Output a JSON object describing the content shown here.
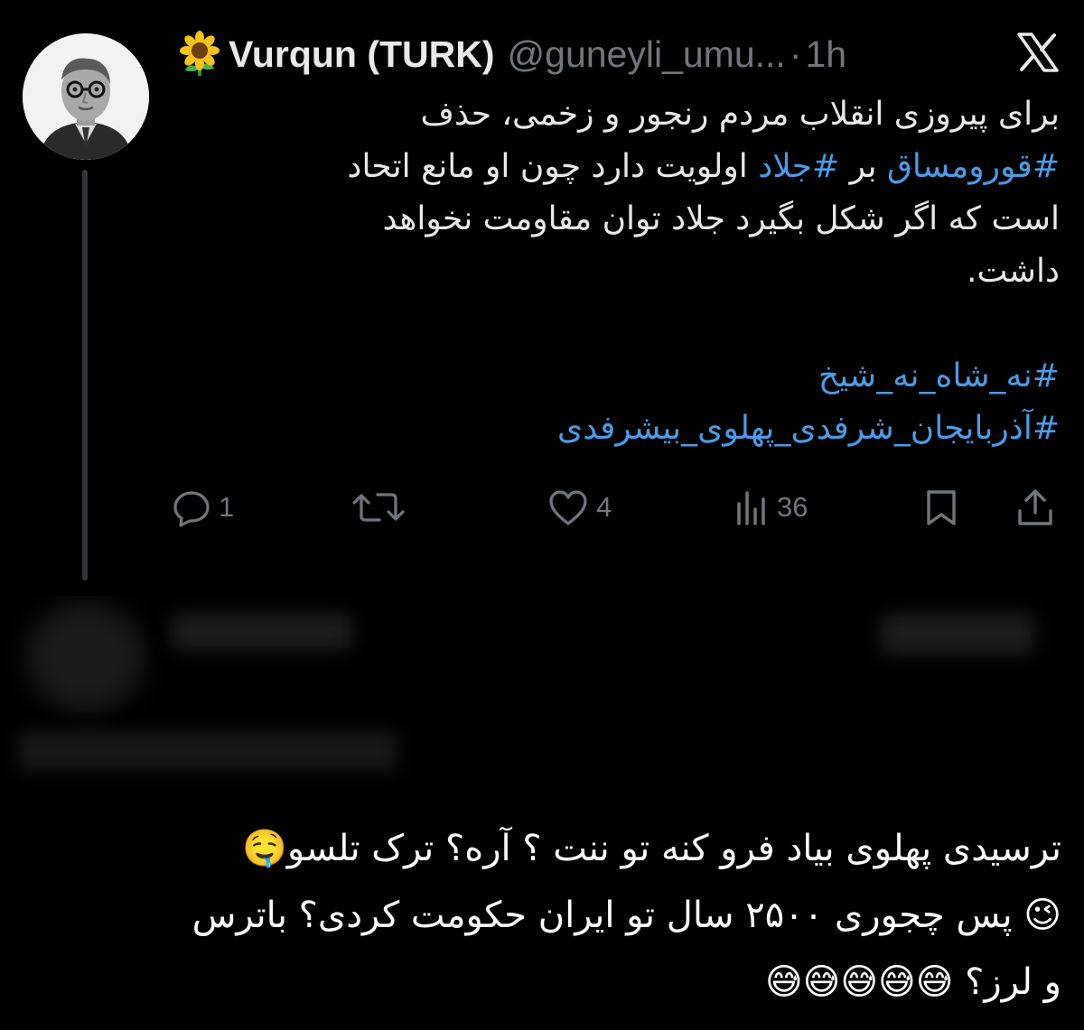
{
  "tweet": {
    "display_name": "Vurqun (TURK)",
    "handle": "@guneyli_umu...",
    "separator": "·",
    "time": "1h",
    "text_lines": [
      "برای پیروزی انقلاب مردم رنجور و زخمی، حذف",
      "اولویت دارد چون او مانع اتحاد",
      "است که اگر شکل بگیرد جلاد توان مقاومت نخواهد",
      "داشت."
    ],
    "line2_hashtag1": "#قورومساق",
    "line2_connector": "بر",
    "line2_hashtag2": "#جلاد",
    "hashtag_a": "#نه_شاه_نه_شیخ",
    "hashtag_b": "#آذربایجان_شرفدی_پهلوی_بیشرفدی"
  },
  "actions": {
    "reply_count": "1",
    "retweet_count": "",
    "like_count": "4",
    "views_count": "36"
  },
  "reply": {
    "lines": [
      "ترسیدی پهلوی بیاد فرو کنه تو ننت ؟ آره؟ ترک تلسو🤤",
      "😉 پس چجوری ۲۵۰۰ سال تو ایران حکومت کردی؟ باترس",
      "و لرز؟ 😅😅😅😅😅"
    ]
  },
  "colors": {
    "background": "#000000",
    "text": "#e7e9ea",
    "muted": "#71767b",
    "hashtag": "#4c9be8"
  },
  "icons": [
    "avatar",
    "sunflower-icon",
    "x-logo-icon",
    "reply-icon",
    "retweet-icon",
    "like-icon",
    "views-icon",
    "bookmark-icon",
    "share-icon"
  ]
}
